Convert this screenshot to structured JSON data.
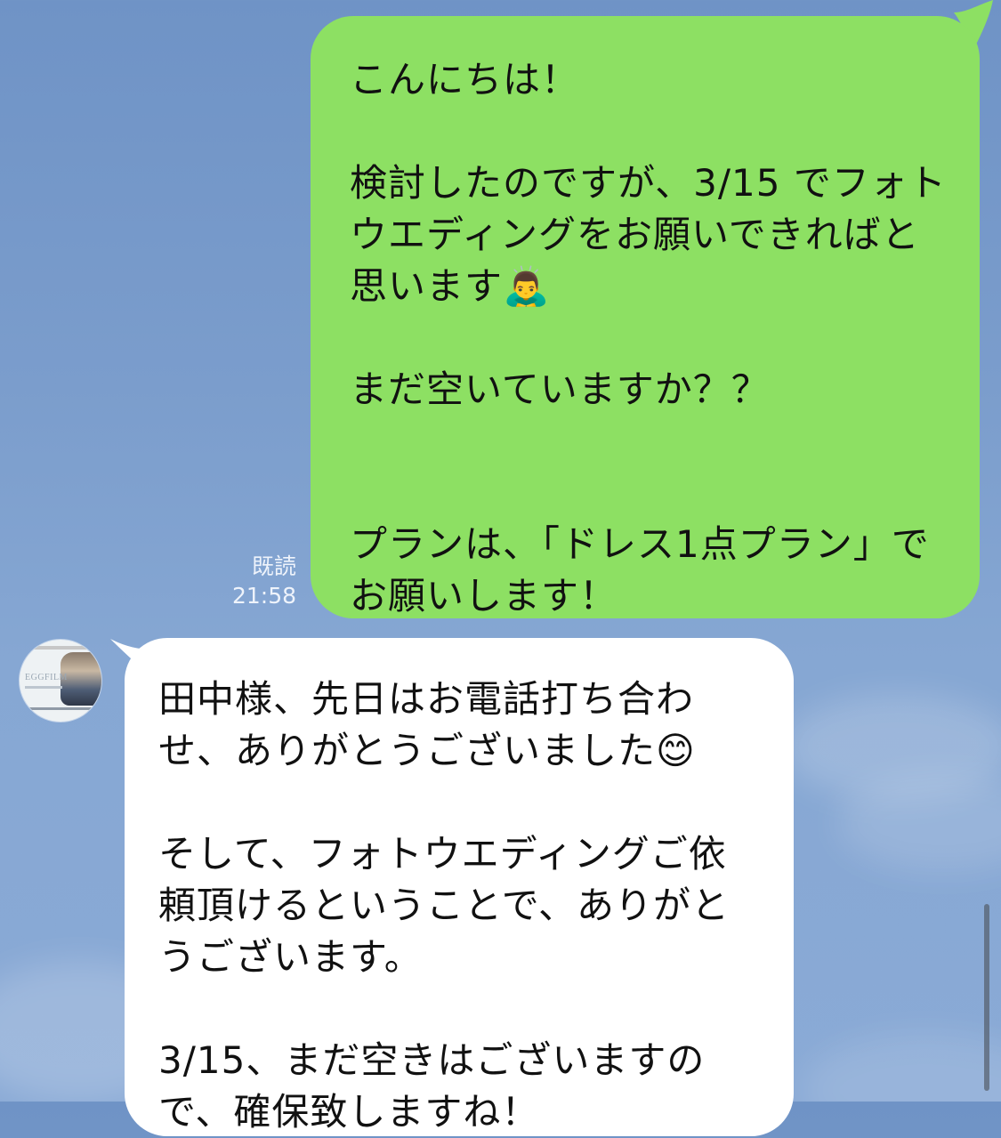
{
  "chat": {
    "outgoing": {
      "text": "こんにちは！\n\n検討したのですが、3/15 でフォトウエディングをお願いできればと思います🙇‍♂️\n\nまだ空いていますか？？\n\n\nプランは、「ドレス1点プラン」でお願いします！",
      "read_label": "既読",
      "time": "21:58"
    },
    "incoming": {
      "text": "田中様、先日はお電話打ち合わせ、ありがとうございました😊\n\nそして、フォトウエディングご依頼頂けるということで、ありがとうございます。\n\n3/15、まだ空きはございますので、確保致しますね！",
      "avatar_logo": "EGGFILM"
    }
  },
  "theme": {
    "outgoing_bubble": "#8de063",
    "incoming_bubble": "#ffffff",
    "background": "#7b9dcc",
    "scrollbar": "#505762"
  }
}
